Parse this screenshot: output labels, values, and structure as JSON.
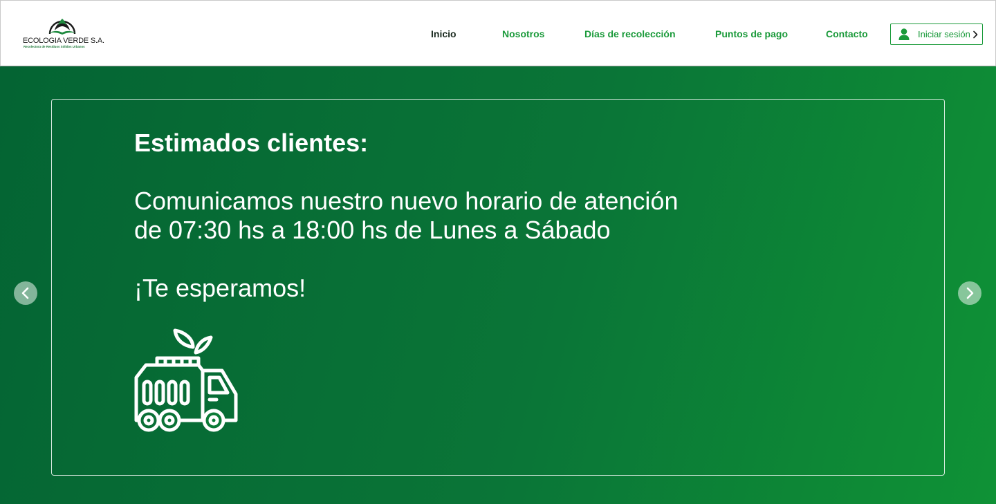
{
  "brand": {
    "name": "ECOLOGIA VERDE S.A.",
    "tagline": "Recolectora de Residuos Sólidos Urbanos",
    "logo_icon": "leaf-logo-icon"
  },
  "nav": {
    "items": [
      {
        "label": "Inicio",
        "active": true
      },
      {
        "label": "Nosotros",
        "active": false
      },
      {
        "label": "Días de recolección",
        "active": false
      },
      {
        "label": "Puntos de pago",
        "active": false
      },
      {
        "label": "Contacto",
        "active": false
      }
    ],
    "login": {
      "label": "Iniciar sesión",
      "icon": "user-icon",
      "chevron": "chevron-right-icon"
    }
  },
  "banner": {
    "greeting": "Estimados clientes:",
    "message_line1": "Comunicamos nuestro nuevo horario de atención",
    "message_line2": "de 07:30 hs a 18:00 hs de Lunes a Sábado",
    "closing": "¡Te esperamos!",
    "illustration_icon": "garbage-truck-icon"
  },
  "carousel": {
    "prev_icon": "chevron-left-icon",
    "next_icon": "chevron-right-icon"
  },
  "colors": {
    "brand_green": "#1a9a3a",
    "hero_start": "#046433",
    "hero_end": "#0f9236",
    "active_nav": "#1a2a1f"
  }
}
